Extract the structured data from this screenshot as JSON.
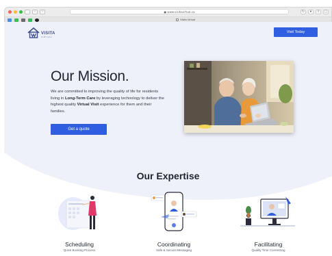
{
  "browser": {
    "url": "● www.visitavirtual.ca",
    "tab_title": "Visita Virtual",
    "nav_back": "‹",
    "nav_forward": "›"
  },
  "header": {
    "logo_text": "VISITA",
    "logo_sub": "VIRTUAL",
    "cta_label": "Visit Today"
  },
  "hero": {
    "title": "Our Mission.",
    "body_1": "We are committed to improving the quality of life for residents living in ",
    "body_bold_1": "Long-Term Care",
    "body_2": " by leveraging technology to deliver the highest quality ",
    "body_bold_2": "Virtual Visit",
    "body_3": " experience for them and their families.",
    "button_label": "Get a quote"
  },
  "expertise": {
    "title": "Our Expertise",
    "cards": [
      {
        "title": "Scheduling",
        "subtitle": "Quick Booking Process"
      },
      {
        "title": "Coordinating",
        "subtitle": "Safe & Secure Messaging"
      },
      {
        "title": "Facilitating",
        "subtitle": "Quality Time Connecting"
      }
    ]
  },
  "colors": {
    "accent": "#2f5fe0",
    "hero_bg": "#eef0fa",
    "text": "#1f2530"
  }
}
